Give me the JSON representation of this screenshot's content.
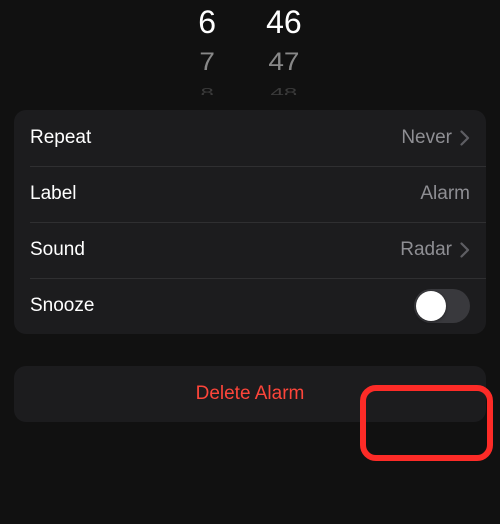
{
  "picker": {
    "hour_center": "6",
    "hour_below1": "7",
    "hour_below2": "8",
    "minute_center": "46",
    "minute_below1": "47",
    "minute_below2": "48"
  },
  "rows": {
    "repeat": {
      "label": "Repeat",
      "value": "Never"
    },
    "label": {
      "label": "Label",
      "value": "Alarm"
    },
    "sound": {
      "label": "Sound",
      "value": "Radar"
    },
    "snooze": {
      "label": "Snooze"
    }
  },
  "delete": {
    "label": "Delete Alarm"
  }
}
